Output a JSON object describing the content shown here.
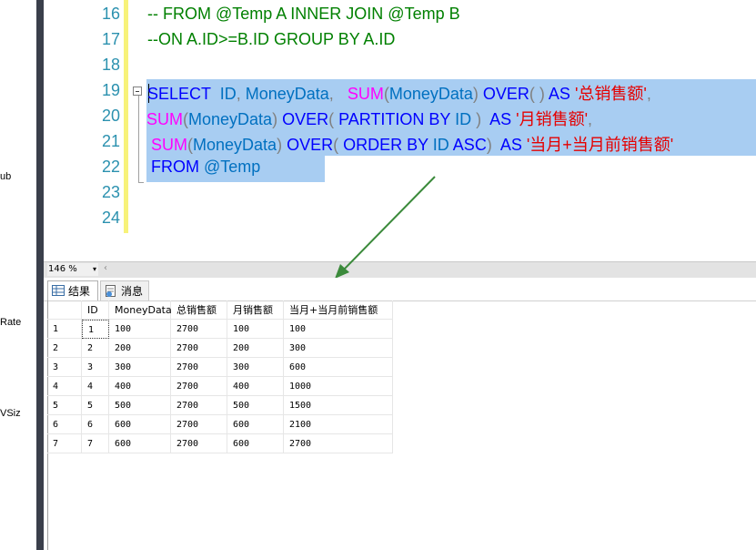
{
  "left_fragments": [
    "ub",
    "Rate",
    "VSiz"
  ],
  "editor": {
    "line_numbers": [
      "16",
      "17",
      "18",
      "19",
      "20",
      "21",
      "22",
      "23",
      "24"
    ],
    "lines": [
      [
        {
          "t": "-- FROM @Temp A INNER JOIN @Temp B",
          "c": "cm"
        }
      ],
      [
        {
          "t": "--ON A.ID>=B.ID GROUP BY A.ID",
          "c": "cm"
        }
      ],
      [],
      [
        {
          "t": "SELECT",
          "c": "kw"
        },
        {
          "t": "  ID",
          "c": "id"
        },
        {
          "t": ",",
          "c": "op"
        },
        {
          "t": " MoneyData",
          "c": "id"
        },
        {
          "t": ",",
          "c": "op"
        },
        {
          "t": "   ",
          "c": "txt"
        },
        {
          "t": "SUM",
          "c": "fn"
        },
        {
          "t": "(",
          "c": "op"
        },
        {
          "t": "MoneyData",
          "c": "id"
        },
        {
          "t": ")",
          "c": "op"
        },
        {
          "t": " OVER",
          "c": "kw"
        },
        {
          "t": "( )",
          "c": "op"
        },
        {
          "t": " AS ",
          "c": "kw"
        },
        {
          "t": "'总销售额'",
          "c": "str"
        },
        {
          "t": ",",
          "c": "op"
        }
      ],
      [
        {
          "t": "SUM",
          "c": "fn"
        },
        {
          "t": "(",
          "c": "op"
        },
        {
          "t": "MoneyData",
          "c": "id"
        },
        {
          "t": ")",
          "c": "op"
        },
        {
          "t": " OVER",
          "c": "kw"
        },
        {
          "t": "(",
          "c": "op"
        },
        {
          "t": " PARTITION BY",
          "c": "kw"
        },
        {
          "t": " ID ",
          "c": "id"
        },
        {
          "t": ")",
          "c": "op"
        },
        {
          "t": "  AS ",
          "c": "kw"
        },
        {
          "t": "'月销售额'",
          "c": "str"
        },
        {
          "t": ",",
          "c": "op"
        }
      ],
      [
        {
          "t": " SUM",
          "c": "fn"
        },
        {
          "t": "(",
          "c": "op"
        },
        {
          "t": "MoneyData",
          "c": "id"
        },
        {
          "t": ")",
          "c": "op"
        },
        {
          "t": " OVER",
          "c": "kw"
        },
        {
          "t": "(",
          "c": "op"
        },
        {
          "t": " ORDER BY",
          "c": "kw"
        },
        {
          "t": " ID",
          "c": "id"
        },
        {
          "t": " ASC",
          "c": "kw"
        },
        {
          "t": ")",
          "c": "op"
        },
        {
          "t": "  AS ",
          "c": "kw"
        },
        {
          "t": "'当月+当月前销售额'",
          "c": "str"
        }
      ],
      [
        {
          "t": " FROM ",
          "c": "kw"
        },
        {
          "t": "@Temp",
          "c": "id"
        }
      ],
      [],
      []
    ]
  },
  "statusbar": {
    "zoom": "146 %",
    "zoom_arrow": "▾",
    "scroll_left": "‹"
  },
  "tabs": {
    "results": "结果",
    "messages": "消息"
  },
  "grid": {
    "columns": [
      "ID",
      "MoneyData",
      "总销售额",
      "月销售额",
      "当月+当月前销售额"
    ],
    "rows": [
      [
        "1",
        "1",
        "100",
        "2700",
        "100",
        "100"
      ],
      [
        "2",
        "2",
        "200",
        "2700",
        "200",
        "300"
      ],
      [
        "3",
        "3",
        "300",
        "2700",
        "300",
        "600"
      ],
      [
        "4",
        "4",
        "400",
        "2700",
        "400",
        "1000"
      ],
      [
        "5",
        "5",
        "500",
        "2700",
        "500",
        "1500"
      ],
      [
        "6",
        "6",
        "600",
        "2700",
        "600",
        "2100"
      ],
      [
        "7",
        "7",
        "600",
        "2700",
        "600",
        "2700"
      ]
    ]
  },
  "colors": {
    "selection": "#a8cdf2",
    "arrow": "#3b8a3b",
    "keyword": "#0000ff",
    "function": "#ff00ff",
    "string": "#e50000",
    "comment": "#008000"
  }
}
